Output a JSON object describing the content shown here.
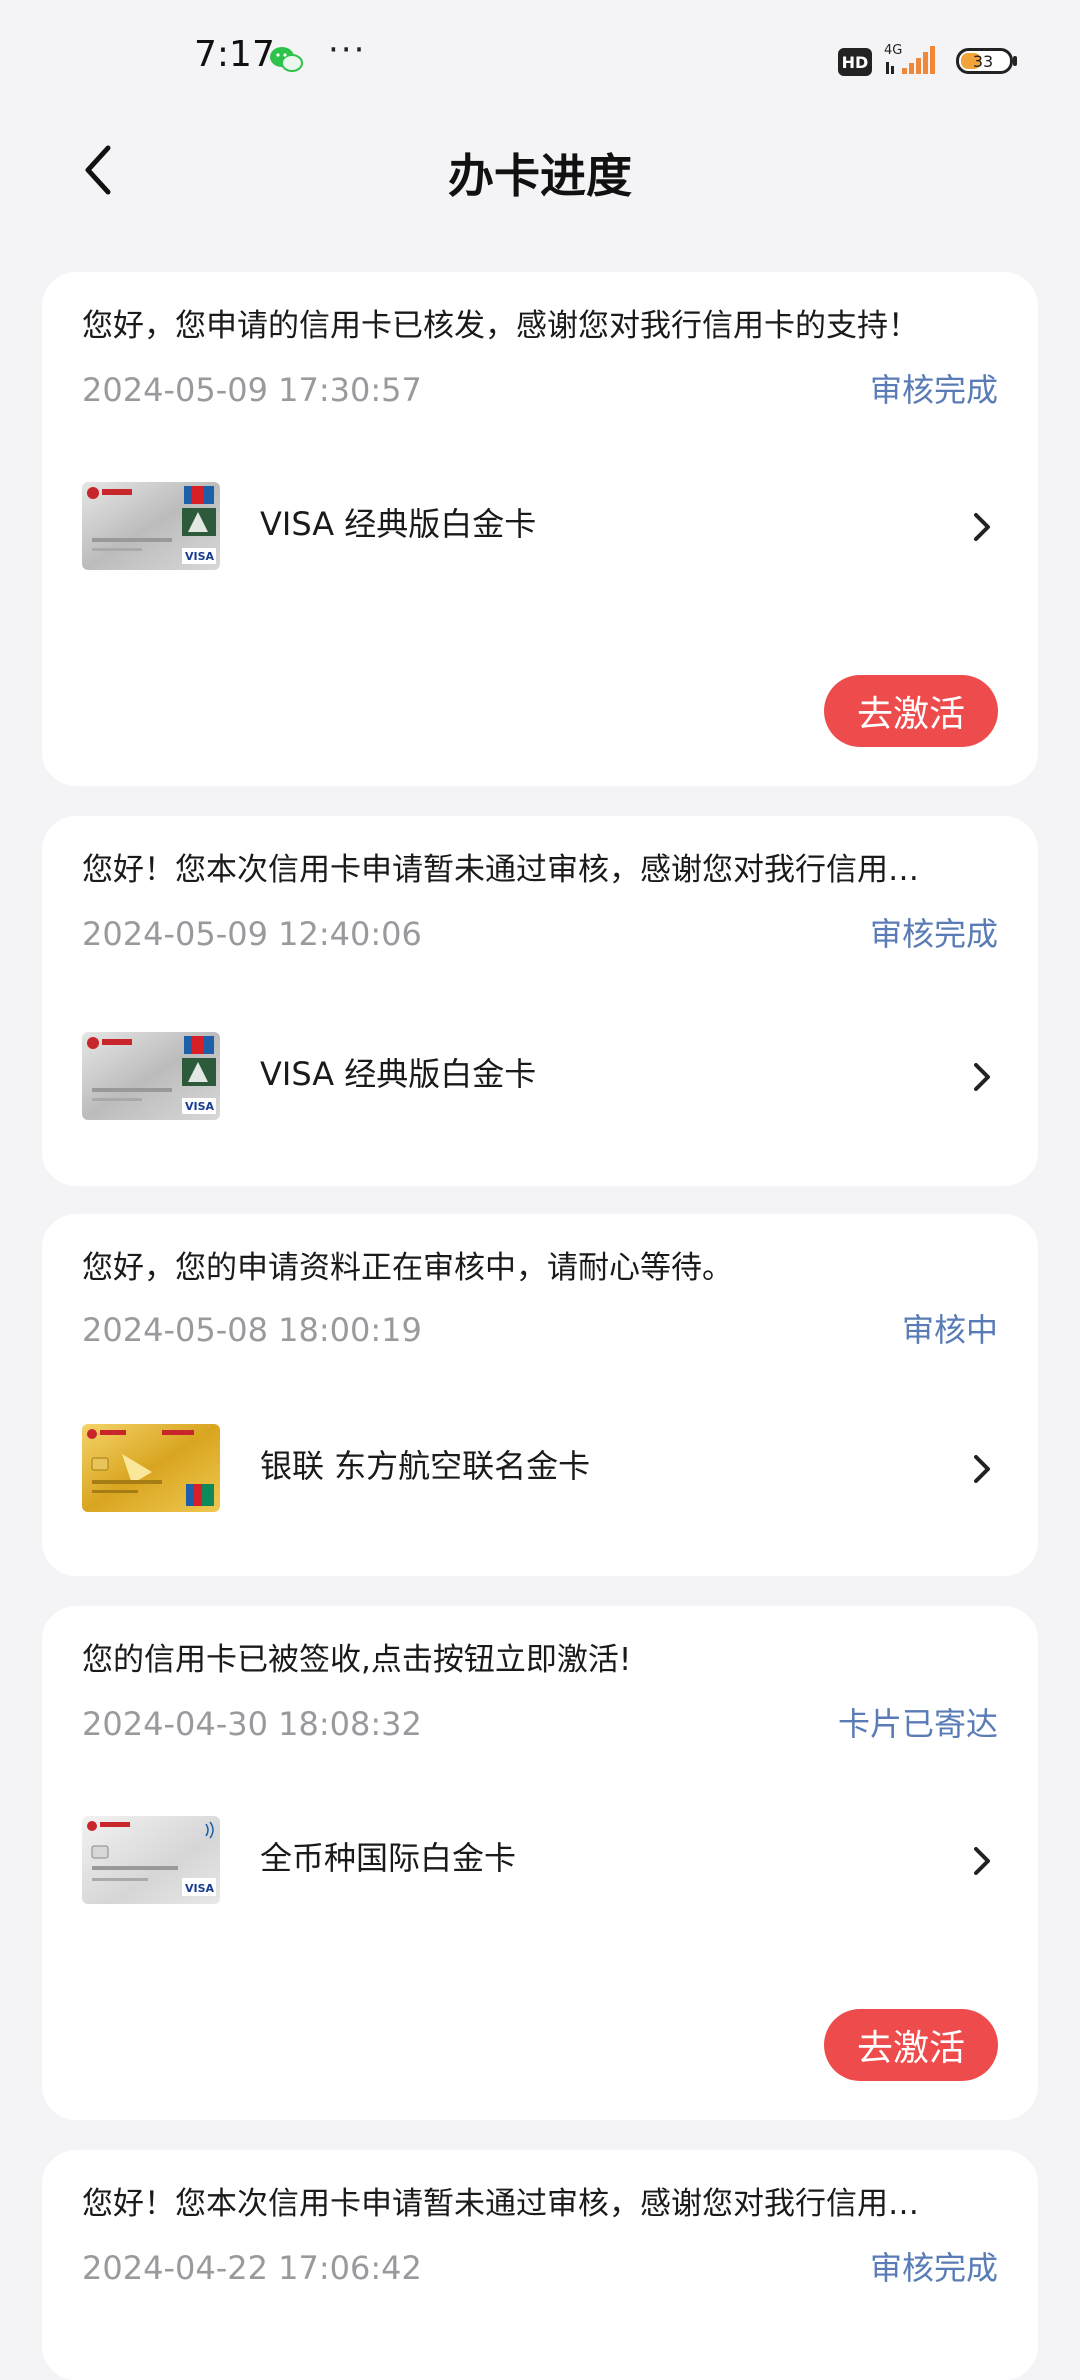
{
  "status_bar": {
    "time": "7:17",
    "dots": "···",
    "hd": "HD",
    "network": "4G",
    "battery": "33"
  },
  "nav": {
    "title": "办卡进度"
  },
  "colors": {
    "status_blue": "#5a7cb6",
    "activate_red": "#ee4c4c",
    "background": "#f4f4f6"
  },
  "cards": [
    {
      "message": "您好，您申请的信用卡已核发，感谢您对我行信用卡的支持！",
      "date": "2024-05-09 17:30:57",
      "status": "审核完成",
      "card_name": "VISA 经典版白金卡",
      "card_image": "silver-visa-card",
      "action": "去激活"
    },
    {
      "message": "您好！您本次信用卡申请暂未通过审核，感谢您对我行信用…",
      "date": "2024-05-09 12:40:06",
      "status": "审核完成",
      "card_name": "VISA 经典版白金卡",
      "card_image": "silver-visa-card"
    },
    {
      "message": "您好，您的申请资料正在审核中，请耐心等待。",
      "date": "2024-05-08 18:00:19",
      "status": "审核中",
      "card_name": "银联 东方航空联名金卡",
      "card_image": "gold-unionpay-card"
    },
    {
      "message": "您的信用卡已被签收,点击按钮立即激活!",
      "date": "2024-04-30 18:08:32",
      "status": "卡片已寄达",
      "card_name": "全币种国际白金卡",
      "card_image": "white-visa-card",
      "action": "去激活"
    },
    {
      "message": "您好！您本次信用卡申请暂未通过审核，感谢您对我行信用…",
      "date": "2024-04-22 17:06:42",
      "status": "审核完成"
    }
  ]
}
